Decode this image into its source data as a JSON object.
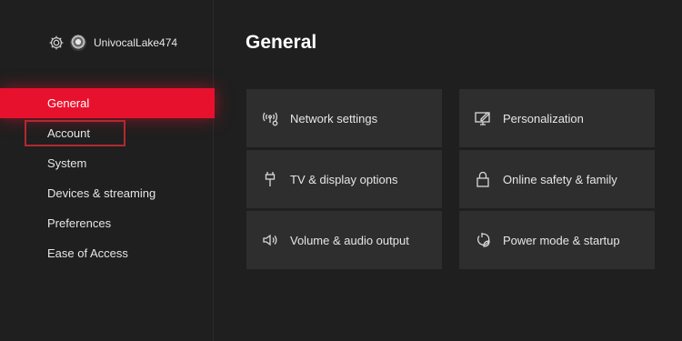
{
  "profile": {
    "gamertag": "UnivocalLake474",
    "settings_icon": "gear-icon",
    "avatar_icon": "avatar"
  },
  "sidebar": {
    "items": [
      {
        "label": "General",
        "state": "active"
      },
      {
        "label": "Account",
        "state": "focused"
      },
      {
        "label": "System"
      },
      {
        "label": "Devices & streaming"
      },
      {
        "label": "Preferences"
      },
      {
        "label": "Ease of Access"
      }
    ]
  },
  "main": {
    "title": "General",
    "tiles": [
      {
        "label": "Network settings",
        "icon": "network-icon"
      },
      {
        "label": "Personalization",
        "icon": "personalization-icon"
      },
      {
        "label": "TV & display options",
        "icon": "display-cable-icon"
      },
      {
        "label": "Online safety & family",
        "icon": "lock-icon"
      },
      {
        "label": "Volume & audio output",
        "icon": "speaker-icon"
      },
      {
        "label": "Power mode & startup",
        "icon": "power-leaf-icon"
      }
    ]
  },
  "colors": {
    "accent": "#e8112d",
    "focus_ring": "#b02a30",
    "background": "#1f1f1f",
    "tile": "#2e2e2e"
  }
}
